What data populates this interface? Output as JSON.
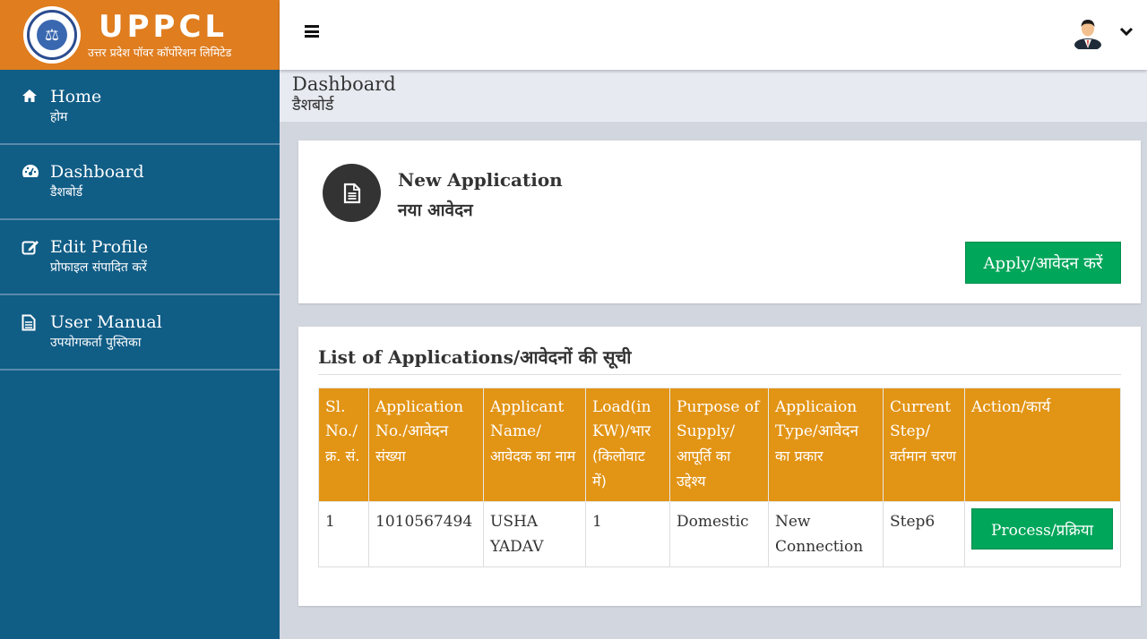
{
  "brand": {
    "title": "UPPCL",
    "subtitle": "उत्तर प्रदेश पॉवर कॉर्पोरेशन लिमिटेड",
    "emblem_glyph": "⚖"
  },
  "topbar": {
    "menu_icon": "hamburger-icon",
    "user_icon": "user-avatar-icon",
    "dropdown_glyph": "⌄"
  },
  "sidebar": {
    "items": [
      {
        "icon": "home-icon",
        "label": "Home",
        "label_hi": "होम"
      },
      {
        "icon": "dashboard-icon",
        "label": "Dashboard",
        "label_hi": "डैशबोर्ड"
      },
      {
        "icon": "edit-icon",
        "label": "Edit Profile",
        "label_hi": "प्रोफाइल संपादित करें"
      },
      {
        "icon": "document-icon",
        "label": "User Manual",
        "label_hi": "उपयोगकर्ता पुस्तिका"
      }
    ]
  },
  "page_header": {
    "title": "Dashboard",
    "title_hi": "डैशबोर्ड"
  },
  "new_application": {
    "icon": "document-icon",
    "title": "New Application",
    "title_hi": "नया आवेदन",
    "apply_label": "Apply/आवेदन करें"
  },
  "applications": {
    "title": "List of Applications/आवेदनों की सूची",
    "columns": [
      {
        "en": "Sl. No./",
        "hi": "क्र. सं."
      },
      {
        "en": "Application No./आवेदन",
        "hi": "संख्या"
      },
      {
        "en": "Applicant Name/",
        "hi": "आवेदक का नाम"
      },
      {
        "en": "Load(in KW)/भार",
        "hi": "(किलोवाट में)"
      },
      {
        "en": "Purpose of Supply/",
        "hi": "आपूर्ति का उद्देश्य"
      },
      {
        "en": "Applicaion Type/आवेदन",
        "hi": "का प्रकार"
      },
      {
        "en": "Current Step/",
        "hi": "वर्तमान चरण"
      },
      {
        "en": "Action/कार्य",
        "hi": ""
      }
    ],
    "rows": [
      {
        "sl_no": "1",
        "application_no": "1010567494",
        "applicant_name": "USHA YADAV",
        "load_kw": "1",
        "purpose": "Domestic",
        "type": "New Connection",
        "current_step": "Step6",
        "action_label": "Process/प्रक्रिया"
      }
    ]
  },
  "colors": {
    "brand_orange": "#df7d1f",
    "sidebar_blue": "#105d86",
    "table_header": "#e29415",
    "button_green": "#00a65a"
  }
}
